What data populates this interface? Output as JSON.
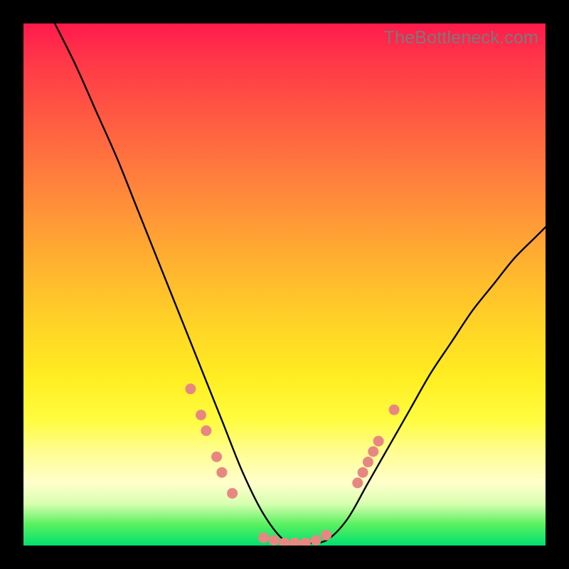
{
  "watermark": "TheBottleneck.com",
  "chart_data": {
    "type": "line",
    "title": "",
    "xlabel": "",
    "ylabel": "",
    "xlim": [
      0,
      100
    ],
    "ylim": [
      0,
      100
    ],
    "series": [
      {
        "name": "bottleneck-curve",
        "x": [
          6,
          10,
          14,
          18,
          22,
          26,
          30,
          34,
          38,
          42,
          46,
          50,
          54,
          58,
          62,
          66,
          70,
          74,
          78,
          82,
          86,
          90,
          94,
          98,
          100
        ],
        "y": [
          100,
          92,
          83,
          74,
          64,
          54,
          44,
          34,
          24,
          14,
          6,
          1,
          0.5,
          1,
          5,
          12,
          19,
          26,
          33,
          39,
          45,
          50,
          55,
          59,
          61
        ]
      }
    ],
    "markers": {
      "name": "highlighted-points",
      "points": [
        {
          "x": 32,
          "y": 30
        },
        {
          "x": 34,
          "y": 25
        },
        {
          "x": 35,
          "y": 22
        },
        {
          "x": 37,
          "y": 17
        },
        {
          "x": 38,
          "y": 14
        },
        {
          "x": 40,
          "y": 10
        },
        {
          "x": 46,
          "y": 1.5
        },
        {
          "x": 48,
          "y": 1
        },
        {
          "x": 50,
          "y": 0.5
        },
        {
          "x": 52,
          "y": 0.5
        },
        {
          "x": 54,
          "y": 0.5
        },
        {
          "x": 56,
          "y": 1
        },
        {
          "x": 58,
          "y": 2
        },
        {
          "x": 64,
          "y": 12
        },
        {
          "x": 65,
          "y": 14
        },
        {
          "x": 66,
          "y": 16
        },
        {
          "x": 67,
          "y": 18
        },
        {
          "x": 68,
          "y": 20
        },
        {
          "x": 71,
          "y": 26
        }
      ]
    },
    "gradient_stops": [
      {
        "pos": 0,
        "color": "#ff1a4d"
      },
      {
        "pos": 50,
        "color": "#ffd426"
      },
      {
        "pos": 90,
        "color": "#ffffcc"
      },
      {
        "pos": 100,
        "color": "#00e070"
      }
    ]
  }
}
